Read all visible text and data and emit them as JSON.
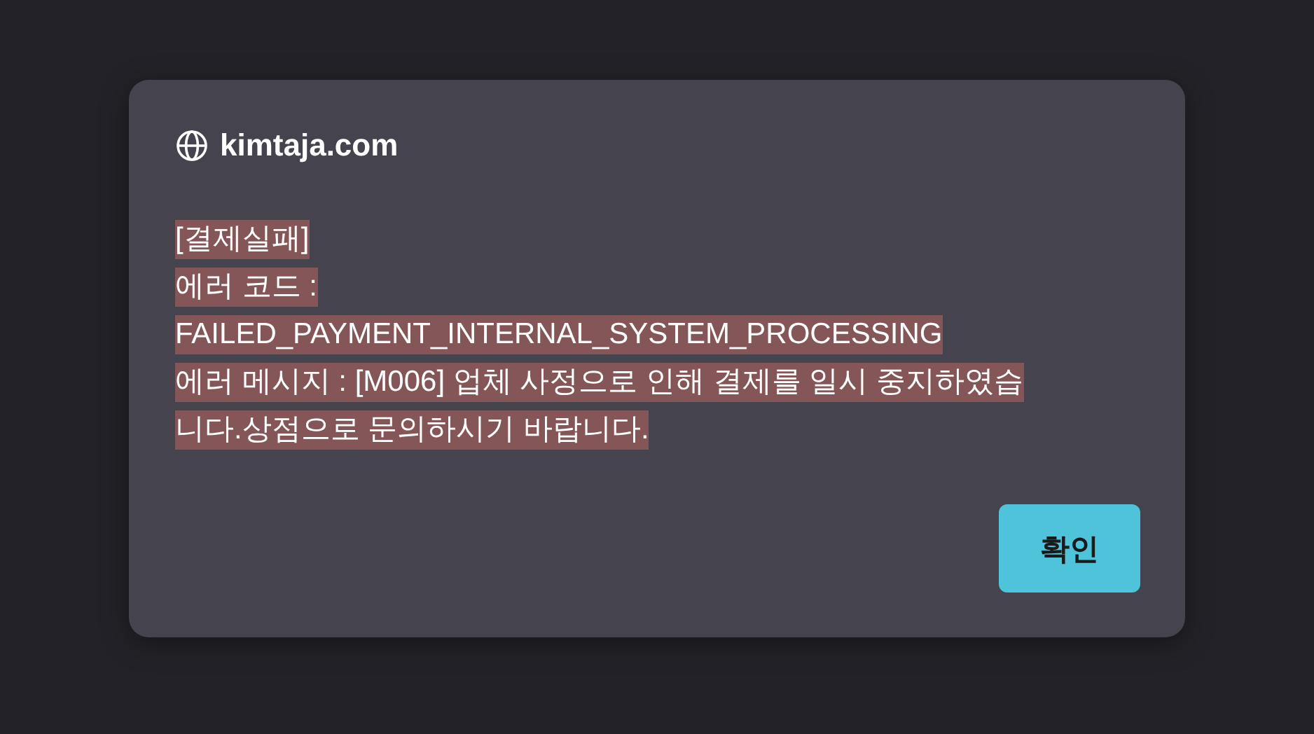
{
  "dialog": {
    "site": "kimtaja.com",
    "message": {
      "lines": [
        "[결제실패]",
        "에러 코드 :",
        "FAILED_PAYMENT_INTERNAL_SYSTEM_PROCESSING",
        "에러 메시지 : [M006] 업체 사정으로 인해 결제를 일시 중지하였습",
        "니다.상점으로 문의하시기 바랍니다."
      ],
      "selected": true
    },
    "buttons": [
      "확인"
    ]
  }
}
